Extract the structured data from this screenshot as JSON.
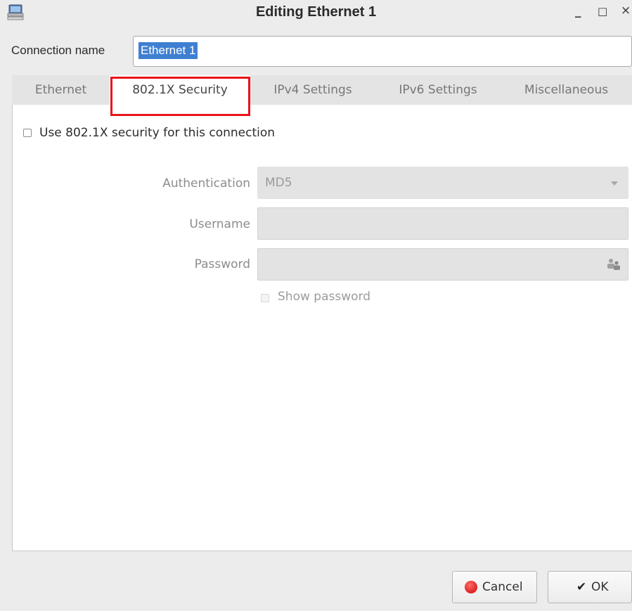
{
  "window": {
    "title": "Editing Ethernet 1",
    "minimize_glyph": "_",
    "maximize_glyph": "□",
    "close_glyph": "×",
    "app_icon": "network-computer-icon"
  },
  "connection": {
    "label": "Connection name",
    "value": "Ethernet 1"
  },
  "tabs": [
    {
      "label": "Ethernet",
      "active": false
    },
    {
      "label": "802.1X Security",
      "active": true
    },
    {
      "label": "IPv4 Settings",
      "active": false
    },
    {
      "label": "IPv6 Settings",
      "active": false
    },
    {
      "label": "Miscellaneous",
      "active": false
    }
  ],
  "security": {
    "use_8021x_label": "Use 802.1X security for this connection",
    "use_8021x_checked": false,
    "authentication_label": "Authentication",
    "authentication_value": "MD5",
    "username_label": "Username",
    "username_value": "",
    "password_label": "Password",
    "password_value": "",
    "show_password_label": "Show password",
    "show_password_checked": false
  },
  "buttons": {
    "cancel": "Cancel",
    "ok": "OK",
    "ok_glyph": "✔"
  },
  "colors": {
    "highlight": "#e8141b",
    "selection": "#3f7fd2"
  }
}
